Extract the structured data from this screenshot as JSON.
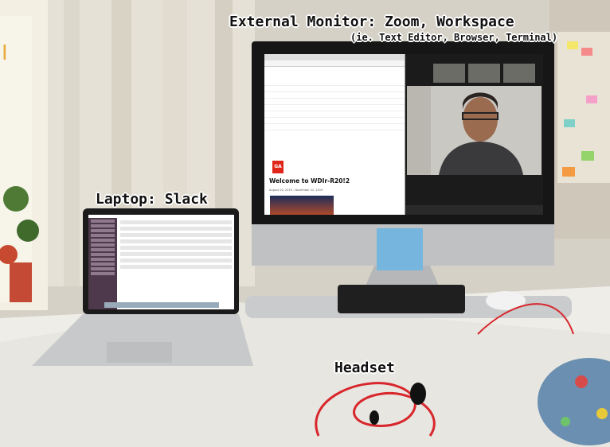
{
  "labels": {
    "external_monitor": "External Monitor: Zoom, Workspace",
    "external_monitor_sub": "(ie. Text Editor, Browser, Terminal)",
    "laptop": "Laptop: Slack",
    "headset": "Headset"
  },
  "browser_page": {
    "welcome": "Welcome to WDIr-R20!2",
    "dates": "August 20, 2019 - November 22, 2019",
    "logo_text": "GA"
  },
  "colors": {
    "ga_red": "#e0261b",
    "sticky_note": "#76b6de",
    "headset_cable": "#d8262c",
    "slack_sidebar": "#4d394b"
  }
}
